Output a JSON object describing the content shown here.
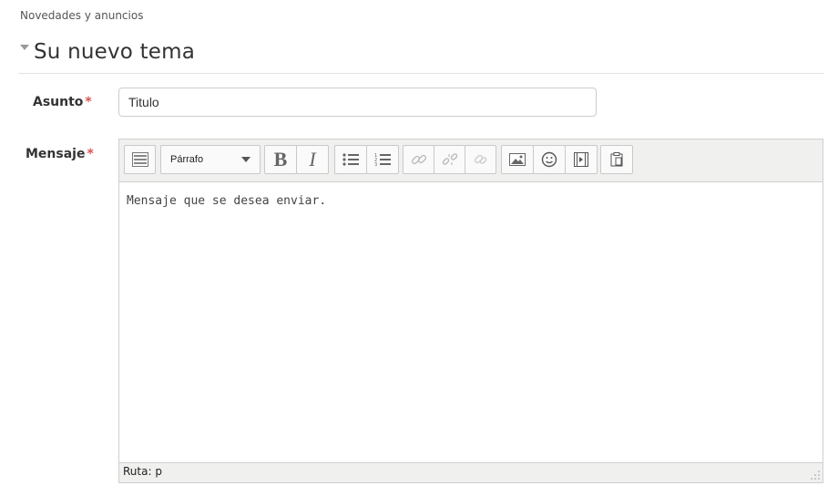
{
  "breadcrumb": "Novedades y anuncios",
  "section": {
    "title": "Su nuevo tema"
  },
  "form": {
    "subject_label": "Asunto",
    "required_mark": "*",
    "subject_value": "Titulo",
    "message_label": "Mensaje"
  },
  "editor": {
    "format_select": "Párrafo",
    "bold": "B",
    "italic": "I",
    "content": "Mensaje que se desea enviar.",
    "path": "Ruta: p",
    "toolbar_icons": [
      "toolbar-toggle-icon",
      "bold-icon",
      "italic-icon",
      "bullet-list-icon",
      "numbered-list-icon",
      "link-icon",
      "unlink-icon",
      "anchor-icon",
      "image-icon",
      "emoticon-icon",
      "media-icon",
      "paste-icon"
    ]
  },
  "colors": {
    "required": "#d9534f",
    "toolbar_bg": "#f0f0ee",
    "border": "#cfcfcf"
  }
}
